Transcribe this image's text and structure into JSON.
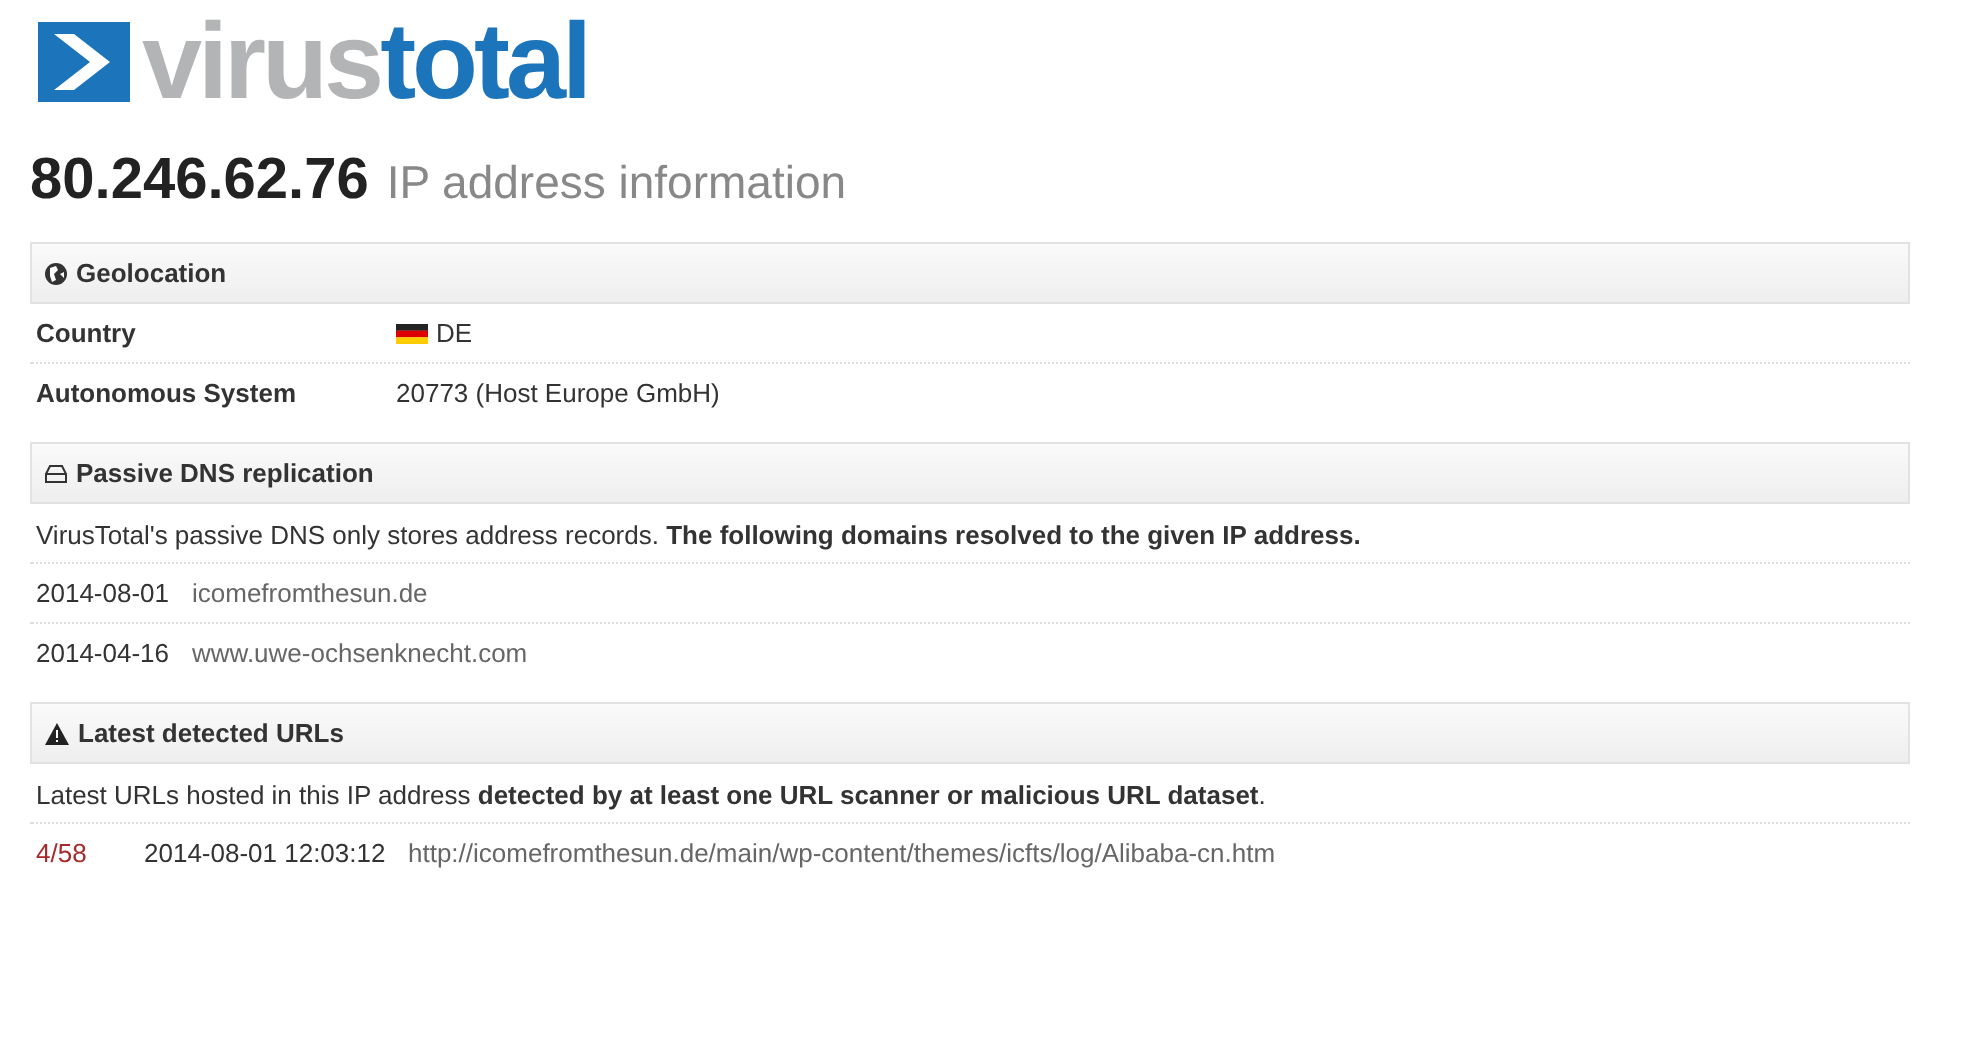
{
  "logo": {
    "first": "virus",
    "second": "total"
  },
  "heading": {
    "ip": "80.246.62.76",
    "subtitle": "IP address information"
  },
  "sections": [
    {
      "kind": "properties",
      "title": "Geolocation",
      "rows": [
        {
          "label": "Country",
          "value": "DE",
          "flag": true
        },
        {
          "label": "Autonomous System",
          "value": "20773 (Host Europe GmbH)",
          "flag": false
        }
      ]
    },
    {
      "kind": "resolutions",
      "title": "Passive DNS replication",
      "intro": "VirusTotal's passive DNS only stores address records. **The following domains resolved to the given IP address.**",
      "rows": [
        {
          "date": "2014-08-01",
          "domain": "icomefromthesun.de"
        },
        {
          "date": "2014-04-16",
          "domain": "www.uwe-ochsenknecht.com"
        }
      ]
    },
    {
      "kind": "urls",
      "title": "Latest detected URLs",
      "intro": "Latest URLs hosted in this IP address **detected by at least one URL scanner or malicious URL dataset**.",
      "rows": [
        {
          "ratio": "4/58",
          "date": "2014-08-01 12:03:12",
          "url": "http://icomefromthesun.de/main/wp-content/themes/icfts/log/Alibaba-cn.htm"
        }
      ]
    }
  ]
}
